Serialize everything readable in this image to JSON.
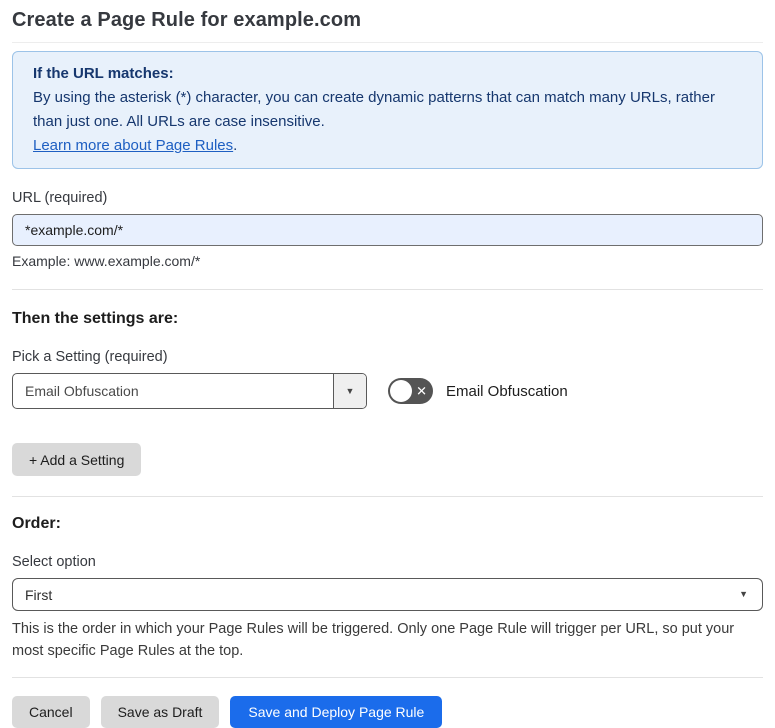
{
  "page": {
    "title": "Create a Page Rule for example.com"
  },
  "info_box": {
    "heading": "If the URL matches:",
    "body": "By using the asterisk (*) character, you can create dynamic patterns that can match many URLs, rather than just one. All URLs are case insensitive.",
    "link_label": "Learn more about Page Rules",
    "link_suffix": "."
  },
  "url_field": {
    "label": "URL (required)",
    "value": "*example.com/*",
    "helper": "Example: www.example.com/*"
  },
  "settings_section": {
    "heading": "Then the settings are:",
    "picker_label": "Pick a Setting (required)",
    "picker_value": "Email Obfuscation",
    "toggle_label": "Email Obfuscation",
    "toggle_state": "off",
    "add_setting_label": "+ Add a Setting"
  },
  "order_section": {
    "heading": "Order:",
    "select_label": "Select option",
    "select_value": "First",
    "helper": "This is the order in which your Page Rules will be triggered. Only one Page Rule will trigger per URL, so put your most specific Page Rules at the top."
  },
  "footer": {
    "cancel_label": "Cancel",
    "save_draft_label": "Save as Draft",
    "save_deploy_label": "Save and Deploy Page Rule"
  },
  "icons": {
    "setting_select_arrow": "chevron-down-icon",
    "order_select_arrow": "chevron-down-icon",
    "toggle_off_glyph": "x-icon"
  },
  "colors": {
    "info_background": "#e8f1fb",
    "info_border": "#9cc3e8",
    "info_text": "#16376e",
    "link": "#1e5fc2",
    "input_highlight_background": "#e8f0fe",
    "primary_button": "#1b6ceb",
    "gray_button": "#d9d9d9",
    "toggle_off": "#545454"
  }
}
